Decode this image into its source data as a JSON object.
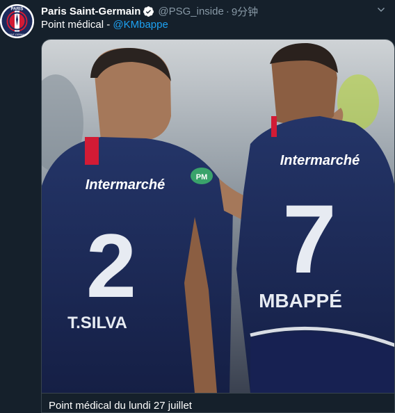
{
  "tweet": {
    "author_name": "Paris Saint-Germain",
    "author_handle": "@PSG_inside",
    "separator": "·",
    "timestamp": "9分钟",
    "text_prefix": "Point médical - ",
    "mention": "@KMbappe",
    "verified": true
  },
  "avatar": {
    "logo_text": "PARIS",
    "logo_subtext": "SAINT-GERMAIN"
  },
  "card": {
    "title": "Point médical du lundi 27 juillet",
    "photo": {
      "player_left": {
        "number": "2",
        "name": "T.SILVA",
        "sponsor": "Intermarché"
      },
      "player_right": {
        "number": "7",
        "name": "MBAPPÉ",
        "sponsor": "Intermarché"
      },
      "sleeve_badge": "PM"
    }
  },
  "colors": {
    "background": "#15202b",
    "link": "#1da1f2",
    "muted": "#8899a6",
    "jersey": "#1c2a5c",
    "psg_red": "#d21b35",
    "border": "#38444d"
  }
}
